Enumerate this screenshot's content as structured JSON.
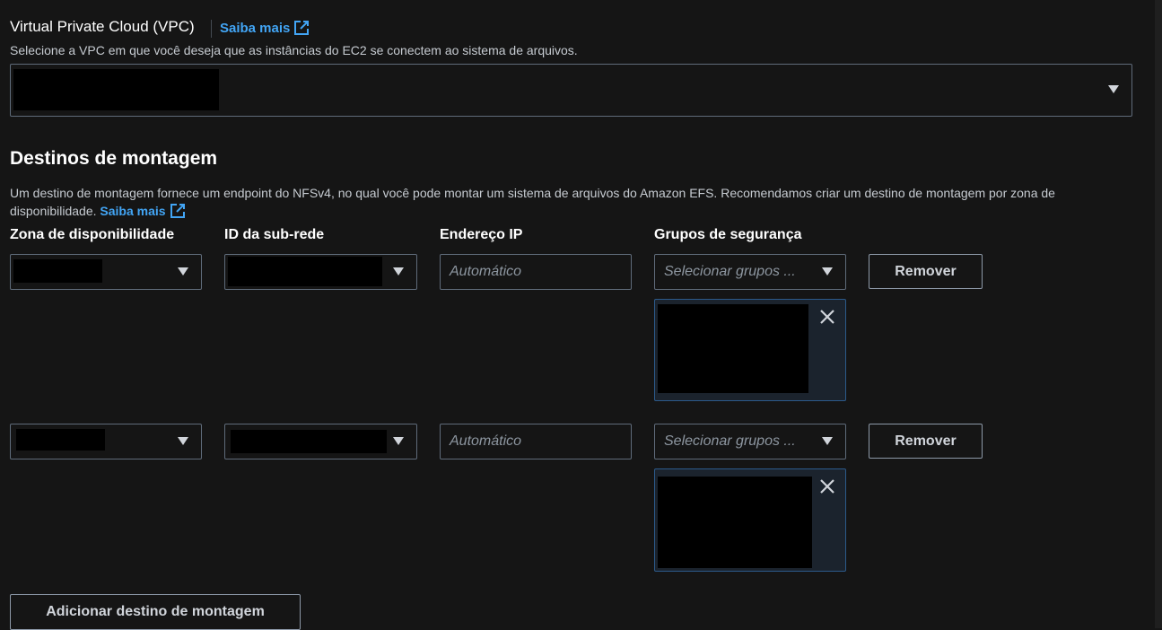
{
  "vpc": {
    "title": "Virtual Private Cloud (VPC)",
    "learn_more": "Saiba mais",
    "description": "Selecione a VPC em que você deseja que as instâncias do EC2 se conectem ao sistema de arquivos."
  },
  "mount_targets": {
    "heading": "Destinos de montagem",
    "description": "Um destino de montagem fornece um endpoint do NFSv4, no qual você pode montar um sistema de arquivos do Amazon EFS. Recomendamos criar um destino de montagem por zona de disponibilidade.",
    "learn_more": "Saiba mais",
    "columns": {
      "zone": "Zona de disponibilidade",
      "subnet": "ID da sub-rede",
      "ip": "Endereço IP",
      "sg": "Grupos de segurança"
    },
    "rows": [
      {
        "ip_placeholder": "Automático",
        "sg_placeholder": "Selecionar grupos ...",
        "remove_label": "Remover"
      },
      {
        "ip_placeholder": "Automático",
        "sg_placeholder": "Selecionar grupos ...",
        "remove_label": "Remover"
      }
    ],
    "add_button": "Adicionar destino de montagem"
  },
  "icons": {
    "external_link": "external-link-icon",
    "dropdown": "caret-down-icon",
    "close": "close-icon"
  },
  "colors": {
    "accent_link": "#42a5f5",
    "token_border": "#2c5a8a"
  }
}
